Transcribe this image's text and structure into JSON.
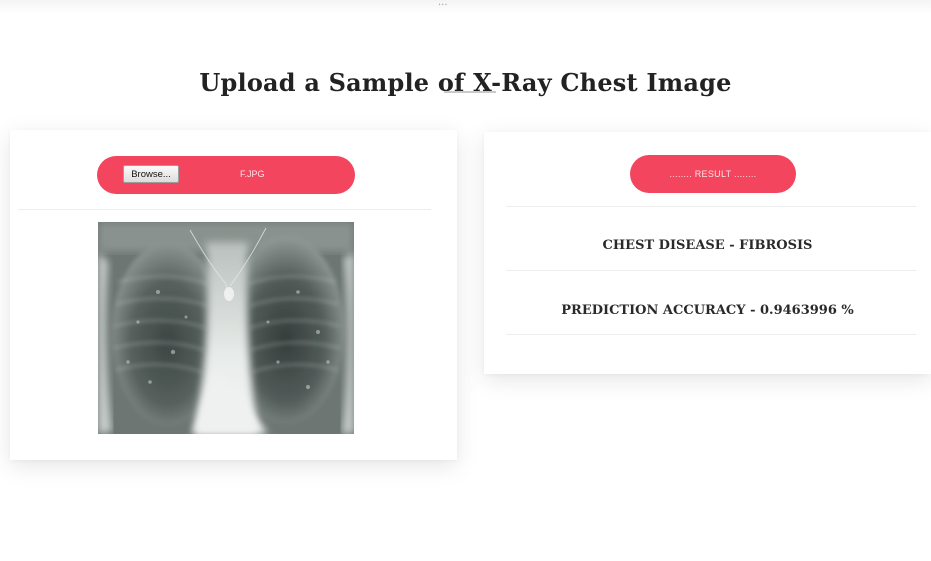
{
  "header": {
    "partial_text": "...",
    "title": "Upload a Sample of X-Ray Chest Image"
  },
  "upload": {
    "browse_label": "Browse...",
    "file_name": "F.JPG",
    "image_desc_icon": "chest-xray-image"
  },
  "result": {
    "header_label": "........ RESULT ........",
    "disease_text": "CHEST DISEASE - FIBROSIS",
    "accuracy_text": "PREDICTION ACCURACY - 0.9463996 %"
  },
  "colors": {
    "accent": "#f4455f",
    "title": "#222222"
  }
}
